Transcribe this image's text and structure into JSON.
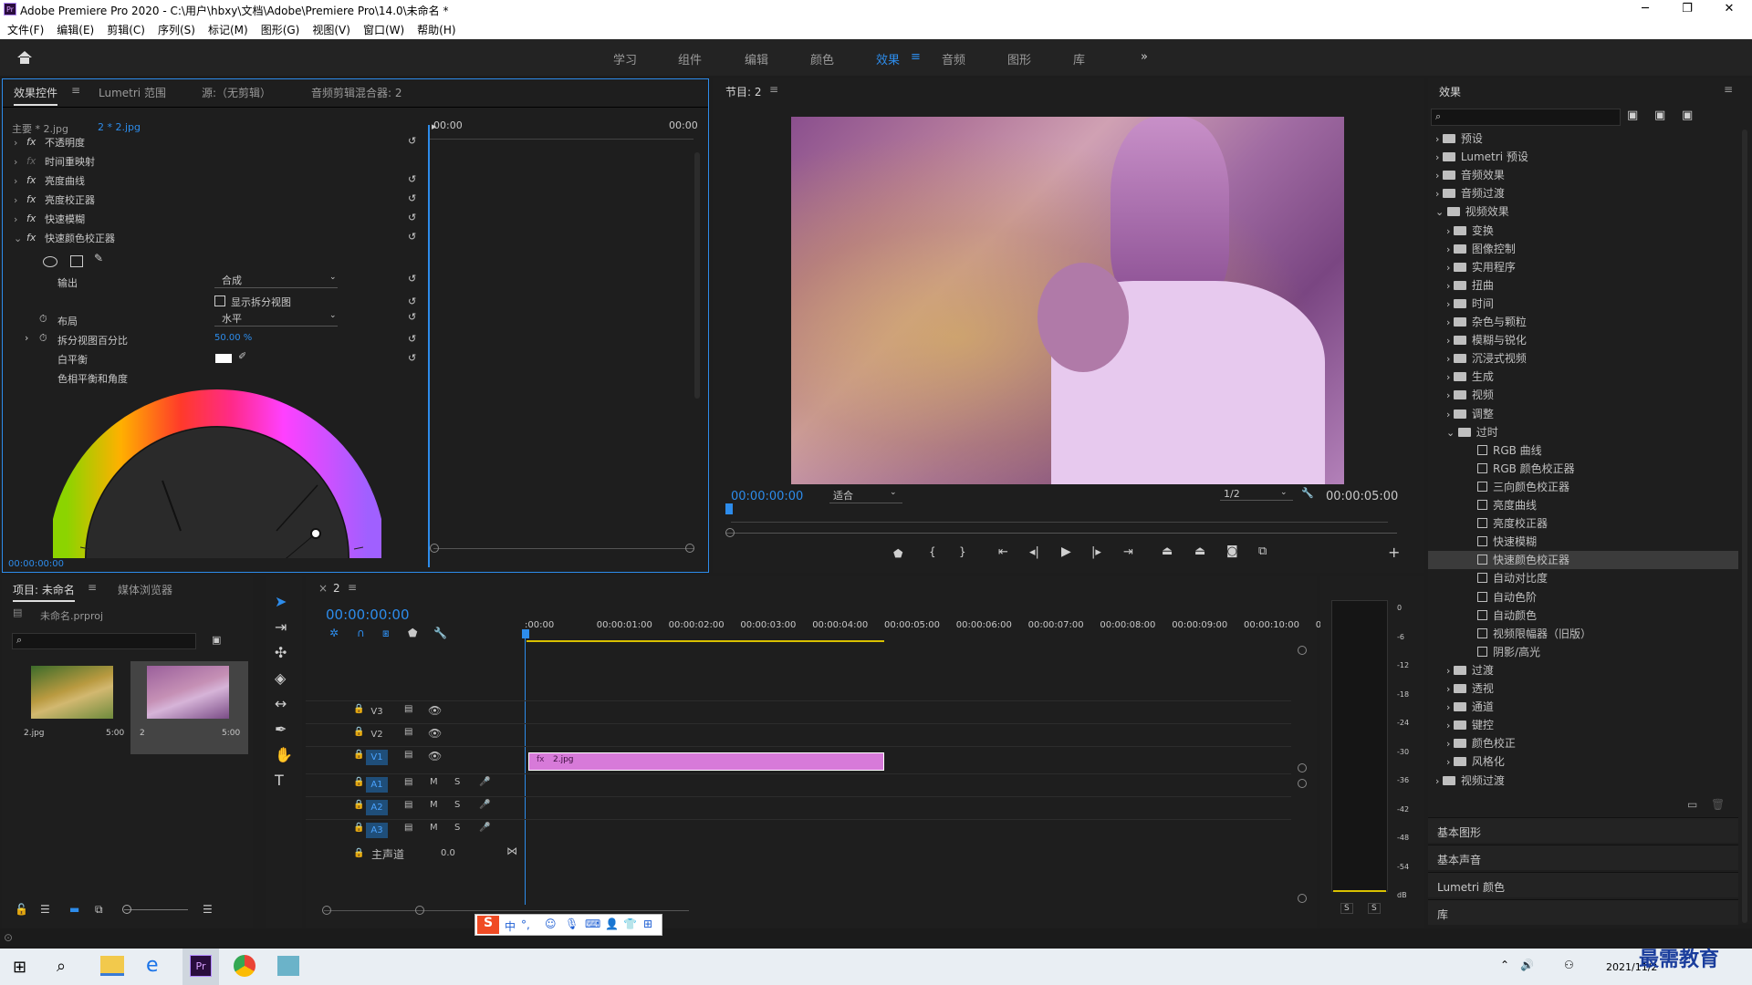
{
  "window": {
    "title": "Adobe Premiere Pro 2020 - C:\\用户\\hbxy\\文档\\Adobe\\Premiere Pro\\14.0\\未命名 *",
    "logo": "Pr"
  },
  "menu": [
    "文件(F)",
    "编辑(E)",
    "剪辑(C)",
    "序列(S)",
    "标记(M)",
    "图形(G)",
    "视图(V)",
    "窗口(W)",
    "帮助(H)"
  ],
  "workspaces": [
    "学习",
    "组件",
    "编辑",
    "颜色",
    "效果",
    "音频",
    "图形",
    "库"
  ],
  "effect_controls": {
    "tabs": [
      "效果控件",
      "Lumetri 范围",
      "源:（无剪辑）",
      "音频剪辑混合器: 2"
    ],
    "master": "主要 * 2.jpg",
    "clip": "2 * 2.jpg",
    "t_start": "00:00",
    "t_end": "00:00",
    "effects": [
      "不透明度",
      "时间重映射",
      "亮度曲线",
      "亮度校正器",
      "快速模糊",
      "快速颜色校正器"
    ],
    "output_label": "输出",
    "output_value": "合成",
    "show_split": "显示拆分视图",
    "layout_label": "布局",
    "layout_value": "水平",
    "split_label": "拆分视图百分比",
    "split_value": "50.00 %",
    "wb_label": "白平衡",
    "hue_label": "色相平衡和角度",
    "timecode": "00:00:00:00"
  },
  "program": {
    "title": "节目: 2",
    "timecode": "00:00:00:00",
    "fit": "适合",
    "res": "1/2",
    "duration": "00:00:05:00",
    "playhead_fraction": 0
  },
  "project": {
    "tabs": [
      "项目: 未命名",
      "媒体浏览器"
    ],
    "file": "未命名.prproj",
    "items": [
      {
        "name": "2.jpg",
        "dur": "5:00"
      },
      {
        "name": "2",
        "dur": "5:00"
      }
    ]
  },
  "timeline": {
    "tab": "2",
    "timecode": "00:00:00:00",
    "ruler": [
      ":00:00",
      "00:00:01:00",
      "00:00:02:00",
      "00:00:03:00",
      "00:00:04:00",
      "00:00:05:00",
      "00:00:06:00",
      "00:00:07:00",
      "00:00:08:00",
      "00:00:09:00",
      "00:00:10:00",
      "0"
    ],
    "video_tracks": [
      "V3",
      "V2",
      "V1"
    ],
    "audio_tracks": [
      "A1",
      "A2",
      "A3"
    ],
    "master": "主声道",
    "master_val": "0.0",
    "clip": "2.jpg"
  },
  "meter": {
    "scale": [
      "0",
      "-6",
      "-12",
      "-18",
      "-24",
      "-30",
      "-36",
      "-42",
      "-48",
      "-54",
      "dB"
    ],
    "s": "S"
  },
  "effects_panel": {
    "title": "效果",
    "tree": [
      {
        "l": "预设",
        "d": 0,
        "t": "f"
      },
      {
        "l": "Lumetri 预设",
        "d": 0,
        "t": "f"
      },
      {
        "l": "音频效果",
        "d": 0,
        "t": "f"
      },
      {
        "l": "音频过渡",
        "d": 0,
        "t": "f"
      },
      {
        "l": "视频效果",
        "d": 0,
        "t": "o"
      },
      {
        "l": "变换",
        "d": 1,
        "t": "f"
      },
      {
        "l": "图像控制",
        "d": 1,
        "t": "f"
      },
      {
        "l": "实用程序",
        "d": 1,
        "t": "f"
      },
      {
        "l": "扭曲",
        "d": 1,
        "t": "f"
      },
      {
        "l": "时间",
        "d": 1,
        "t": "f"
      },
      {
        "l": "杂色与颗粒",
        "d": 1,
        "t": "f"
      },
      {
        "l": "模糊与锐化",
        "d": 1,
        "t": "f"
      },
      {
        "l": "沉浸式视频",
        "d": 1,
        "t": "f"
      },
      {
        "l": "生成",
        "d": 1,
        "t": "f"
      },
      {
        "l": "视频",
        "d": 1,
        "t": "f"
      },
      {
        "l": "调整",
        "d": 1,
        "t": "f"
      },
      {
        "l": "过时",
        "d": 1,
        "t": "o"
      },
      {
        "l": "RGB 曲线",
        "d": 2,
        "t": "p"
      },
      {
        "l": "RGB 颜色校正器",
        "d": 2,
        "t": "p"
      },
      {
        "l": "三向颜色校正器",
        "d": 2,
        "t": "p"
      },
      {
        "l": "亮度曲线",
        "d": 2,
        "t": "p"
      },
      {
        "l": "亮度校正器",
        "d": 2,
        "t": "p"
      },
      {
        "l": "快速模糊",
        "d": 2,
        "t": "p"
      },
      {
        "l": "快速颜色校正器",
        "d": 2,
        "t": "s"
      },
      {
        "l": "自动对比度",
        "d": 2,
        "t": "p"
      },
      {
        "l": "自动色阶",
        "d": 2,
        "t": "p"
      },
      {
        "l": "自动颜色",
        "d": 2,
        "t": "p"
      },
      {
        "l": "视频限幅器（旧版）",
        "d": 2,
        "t": "p"
      },
      {
        "l": "阴影/高光",
        "d": 2,
        "t": "p"
      },
      {
        "l": "过渡",
        "d": 1,
        "t": "f"
      },
      {
        "l": "透视",
        "d": 1,
        "t": "f"
      },
      {
        "l": "通道",
        "d": 1,
        "t": "f"
      },
      {
        "l": "键控",
        "d": 1,
        "t": "f"
      },
      {
        "l": "颜色校正",
        "d": 1,
        "t": "f"
      },
      {
        "l": "风格化",
        "d": 1,
        "t": "f"
      },
      {
        "l": "视频过渡",
        "d": 0,
        "t": "f"
      }
    ],
    "sections": [
      "基本图形",
      "基本声音",
      "Lumetri 颜色",
      "库"
    ]
  },
  "ime": {
    "items": [
      "中",
      "°,"
    ]
  },
  "taskbar": {
    "time": "2021/11/2",
    "watermark": "最需教育"
  },
  "colors": {
    "accent": "#2d8ceb",
    "clip": "#d77ad9",
    "bg": "#1d1d1d"
  }
}
